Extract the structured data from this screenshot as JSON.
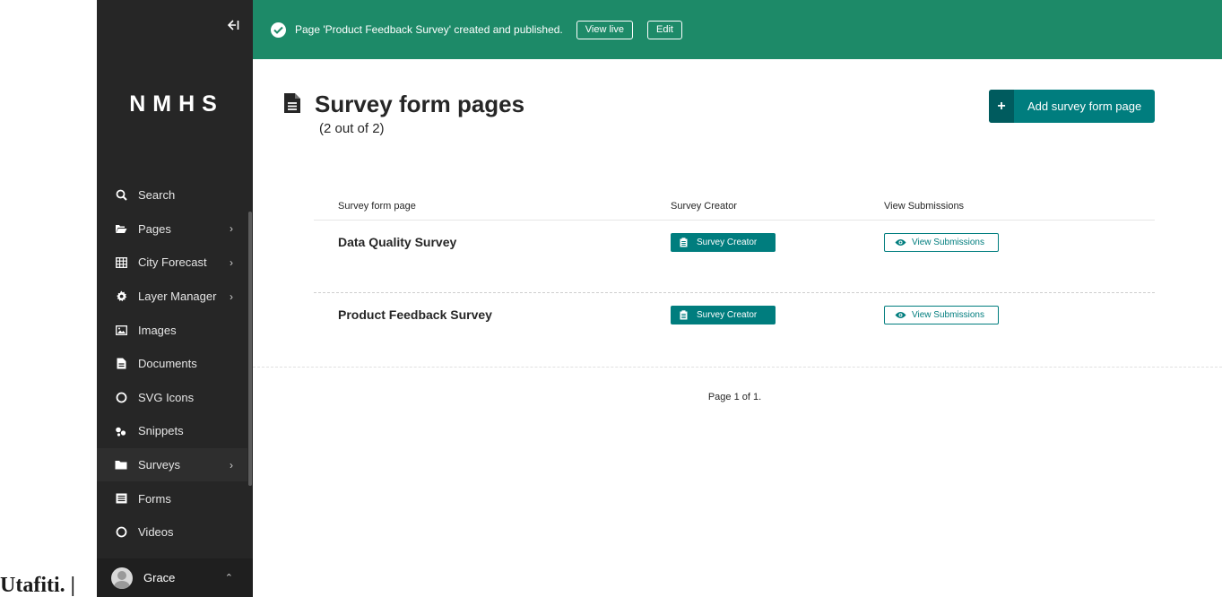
{
  "background": {
    "partial_text": "Utafiti. |"
  },
  "sidebar": {
    "collapse_icon": "collapse-left-icon",
    "logo": "NMHS",
    "items": [
      {
        "label": "Search",
        "icon": "search-icon",
        "has_submenu": false
      },
      {
        "label": "Pages",
        "icon": "folder-open-icon",
        "has_submenu": true
      },
      {
        "label": "City Forecast",
        "icon": "table-icon",
        "has_submenu": true
      },
      {
        "label": "Layer Manager",
        "icon": "cog-icon",
        "has_submenu": true
      },
      {
        "label": "Images",
        "icon": "image-icon",
        "has_submenu": false
      },
      {
        "label": "Documents",
        "icon": "document-icon",
        "has_submenu": false
      },
      {
        "label": "SVG Icons",
        "icon": "circle-icon",
        "has_submenu": false
      },
      {
        "label": "Snippets",
        "icon": "snippet-icon",
        "has_submenu": false
      },
      {
        "label": "Surveys",
        "icon": "folder-icon",
        "has_submenu": true,
        "active": true
      },
      {
        "label": "Forms",
        "icon": "form-icon",
        "has_submenu": false
      },
      {
        "label": "Videos",
        "icon": "circle-icon",
        "has_submenu": false
      }
    ],
    "account": {
      "name": "Grace"
    }
  },
  "banner": {
    "message": "Page 'Product Feedback Survey' created and published.",
    "view_live": "View live",
    "edit": "Edit"
  },
  "header": {
    "title": "Survey form pages",
    "subtitle": "(2 out of 2)",
    "add_button": "Add survey form page"
  },
  "table": {
    "columns": [
      "Survey form page",
      "Survey Creator",
      "View Submissions"
    ],
    "rows": [
      {
        "title": "Data Quality Survey",
        "creator_button": "Survey Creator",
        "submissions_button": "View Submissions"
      },
      {
        "title": "Product Feedback Survey",
        "creator_button": "Survey Creator",
        "submissions_button": "View Submissions"
      }
    ]
  },
  "pagination": "Page 1 of 1.",
  "colors": {
    "sidebar_bg": "#262626",
    "banner_bg": "#1d8a68",
    "accent_teal": "#007d7e",
    "accent_teal_dark": "#005b5e"
  }
}
